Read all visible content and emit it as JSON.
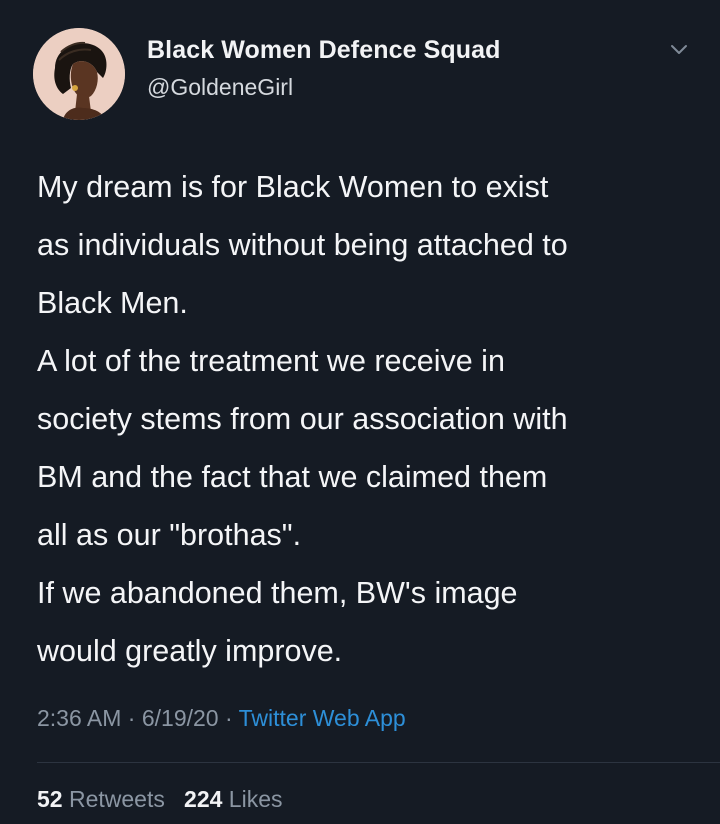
{
  "author": {
    "display_name": "Black Women Defence Squad",
    "handle": "@GoldeneGirl",
    "avatar": "avatar-woman-profile-illustration"
  },
  "menu_icon": "chevron-down-icon",
  "tweet": {
    "lines": [
      "My dream is for Black Women to exist",
      "as individuals without being attached to",
      "Black Men.",
      "A lot of the treatment we receive in",
      "society stems from our association with",
      "BM and the fact that we claimed them",
      "all as our \"brothas\".",
      "If we abandoned them, BW's image",
      "would greatly improve."
    ]
  },
  "meta": {
    "time": "2:36 AM",
    "separator": "·",
    "date": "6/19/20",
    "source": "Twitter Web App"
  },
  "stats": {
    "retweets_count": "52",
    "retweets_label": "Retweets",
    "likes_count": "224",
    "likes_label": "Likes"
  },
  "colors": {
    "background": "#151b24",
    "text": "#f4f5f7",
    "secondary": "#8b96a3",
    "link": "#2d8fd8"
  }
}
